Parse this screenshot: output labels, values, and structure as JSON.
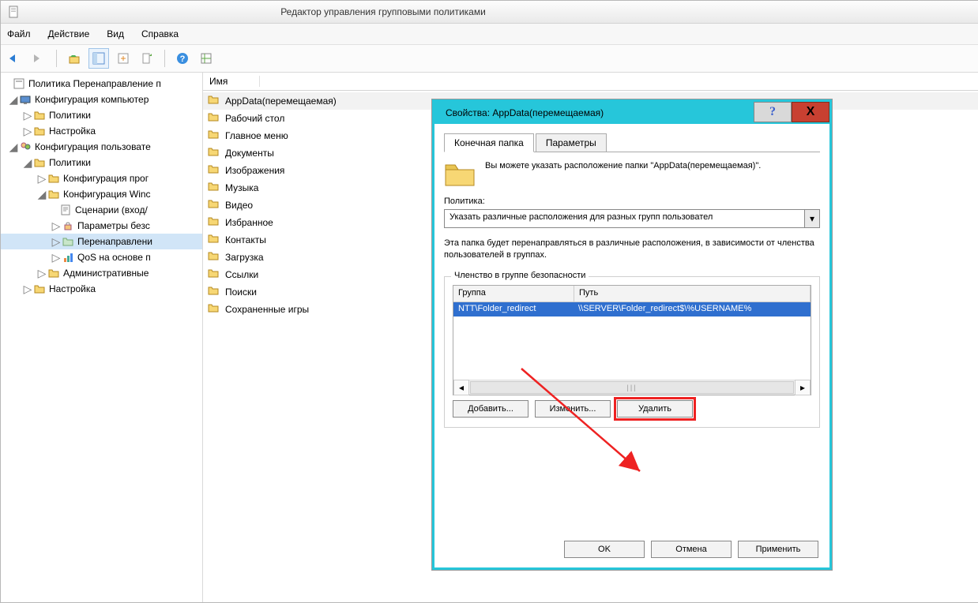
{
  "window_title": "Редактор управления групповыми политиками",
  "menu": {
    "file": "Файл",
    "action": "Действие",
    "view": "Вид",
    "help": "Справка"
  },
  "tree": {
    "root": "Политика Перенаправление п",
    "comp_conf": "Конфигурация компьютер",
    "policies1": "Политики",
    "settings1": "Настройка",
    "user_conf": "Конфигурация пользовате",
    "policies2": "Политики",
    "conf_prog": "Конфигурация прог",
    "conf_win": "Конфигурация Winc",
    "scripts": "Сценарии (вход/",
    "sec_params": "Параметры безс",
    "redirect": "Перенаправлени",
    "qos": "QoS на основе п",
    "admin": "Административные",
    "settings2": "Настройка"
  },
  "list": {
    "header": "Имя",
    "items": [
      "AppData(перемещаемая)",
      "Рабочий стол",
      "Главное меню",
      "Документы",
      "Изображения",
      "Музыка",
      "Видео",
      "Избранное",
      "Контакты",
      "Загрузка",
      "Ссылки",
      "Поиски",
      "Сохраненные игры"
    ]
  },
  "dialog": {
    "title": "Свойства: AppData(перемещаемая)",
    "help": "?",
    "close": "X",
    "tab1": "Конечная папка",
    "tab2": "Параметры",
    "desc": "Вы можете указать расположение папки \"AppData(перемещаемая)\".",
    "policy_label": "Политика:",
    "combo_value": "Указать различные расположения для разных групп пользовател",
    "info": "Эта папка будет перенаправляться в различные расположения, в зависимости от членства пользователей в группах.",
    "group_title": "Членство в группе безопасности",
    "col_group": "Группа",
    "col_path": "Путь",
    "row_group": "NTT\\Folder_redirect",
    "row_path": "\\\\SERVER\\Folder_redirect$\\%USERNAME%",
    "add": "Добавить...",
    "edit": "Изменить...",
    "delete": "Удалить",
    "ok": "OK",
    "cancel": "Отмена",
    "apply": "Применить"
  }
}
